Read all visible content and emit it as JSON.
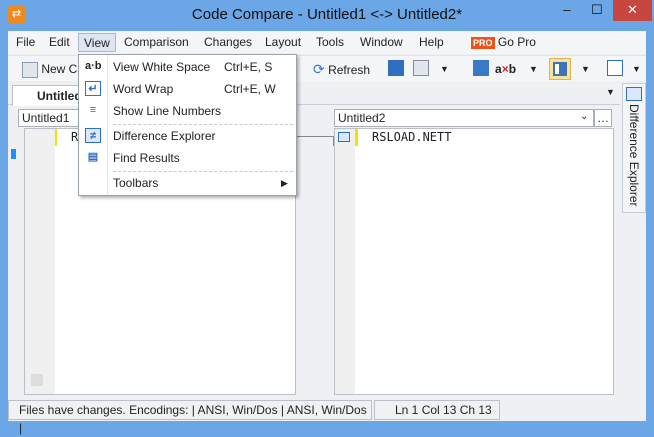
{
  "window": {
    "title": "Code Compare - Untitled1 <-> Untitled2*",
    "minimize": "–",
    "maximize": "☐",
    "close": "✕"
  },
  "menu": [
    "File",
    "Edit",
    "View",
    "Comparison",
    "Changes",
    "Layout",
    "Tools",
    "Window",
    "Help"
  ],
  "go_pro": {
    "badge": "PRO",
    "label": "Go Pro"
  },
  "toolbar": {
    "new_label": "New C",
    "refresh_label": "Refresh"
  },
  "tab": {
    "label": "Untitled"
  },
  "left": {
    "file": "Untitled1",
    "line": "R"
  },
  "right": {
    "file": "Untitled2",
    "line": "RSLOAD.NETT"
  },
  "view_menu": [
    {
      "icon": "a·b",
      "label": "View White Space",
      "shortcut": "Ctrl+E, S"
    },
    {
      "icon": "↵",
      "label": "Word Wrap",
      "shortcut": "Ctrl+E, W"
    },
    {
      "icon": "≡",
      "label": "Show Line Numbers",
      "shortcut": ""
    },
    {
      "icon": "≠",
      "label": "Difference Explorer",
      "shortcut": ""
    },
    {
      "icon": "▤",
      "label": "Find Results",
      "shortcut": ""
    },
    {
      "icon": "",
      "label": "Toolbars",
      "shortcut": ""
    }
  ],
  "side_panel": {
    "label": "Difference Explorer"
  },
  "status": {
    "message": "Files have changes. Encodings:  |   ANSI, Win/Dos  |   ANSI, Win/Dos  |",
    "position": "Ln 1    Col 13    Ch 13"
  }
}
